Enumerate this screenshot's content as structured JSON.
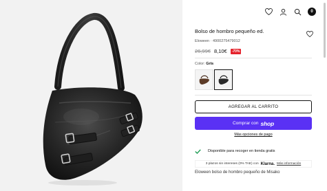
{
  "header": {
    "cart_count": "0",
    "icons": [
      "heart-icon",
      "user-icon",
      "search-icon",
      "cart-icon"
    ]
  },
  "product": {
    "title": "Bolso de hombro pequeño ed.",
    "meta": "Eloween · 4900275479012",
    "old_price": "26,99€",
    "new_price": "8,10€",
    "discount": "-70%",
    "color_label": "Color:",
    "color_value": "Gris"
  },
  "buttons": {
    "add_to_cart": "AGREGAR AL CARRITO",
    "buy_with": "Comprar con",
    "shop_logo": "shop",
    "more_payment": "Más opciones de pago"
  },
  "pickup": {
    "text": "Disponible para recoger en tienda gratis"
  },
  "klarna": {
    "text": "3 plazos sin intereses (0% TAE) con",
    "logo": "Klarna.",
    "more": "Más información"
  },
  "description": {
    "text": "Eloween bolso de hombro pequeño de Misako"
  },
  "colors": {
    "accent": "#5a31f4",
    "discount": "#e4222b",
    "check": "#1f9d55"
  }
}
